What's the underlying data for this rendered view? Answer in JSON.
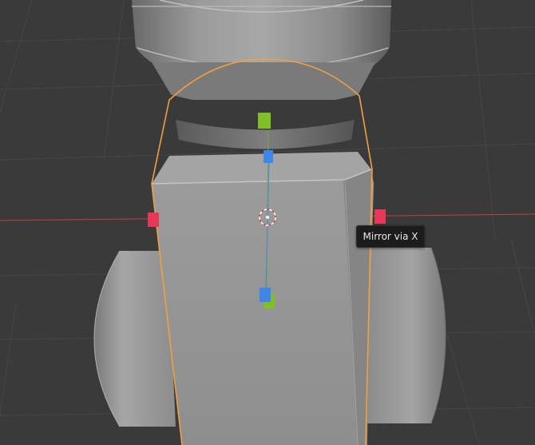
{
  "viewport": {
    "background": "#3a3a3a",
    "selection_outline_color": "#f0a040",
    "x_axis_color": "#d44040"
  },
  "gizmo": {
    "x_handle_color": "#e8385a",
    "y_handle_color": "#7ec026",
    "z_handle_color": "#3f86e8",
    "pivot_icon": "pivot-cursor-icon"
  },
  "tooltip": {
    "text": "Mirror via X"
  }
}
